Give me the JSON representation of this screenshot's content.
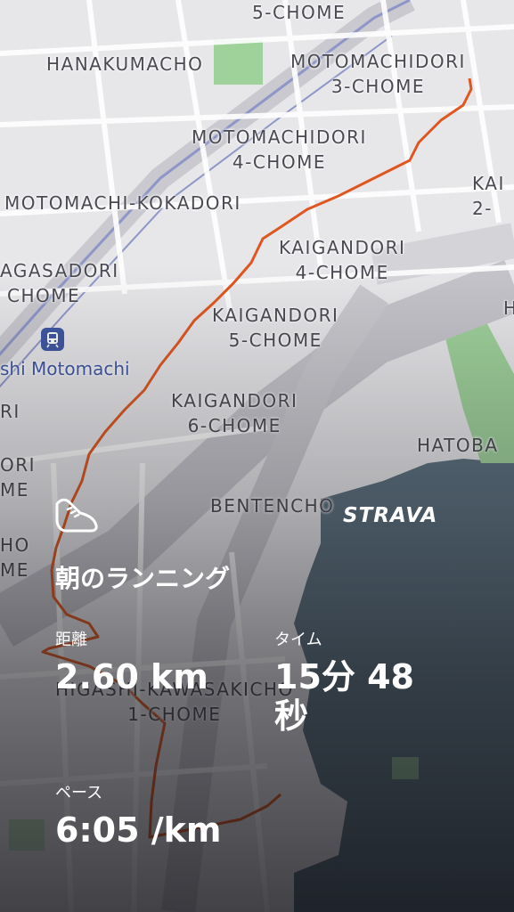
{
  "map": {
    "labels": {
      "chome5_top": "5-CHOME",
      "hanakumacho": "HANAKUMACHO",
      "motomachidori3_a": "MOTOMACHIDORI",
      "motomachidori3_b": "3-CHOME",
      "motomachidori4_a": "MOTOMACHIDORI",
      "motomachidori4_b": "4-CHOME",
      "kokadori": "MOTOMACHI-KOKADORI",
      "kaigandori4_a": "KAIGANDORI",
      "kaigandori4_b": "4-CHOME",
      "nagasadori_a": "AGASADORI",
      "nagasadori_b": "CHOME",
      "kaigandori5_a": "KAIGANDORI",
      "kaigandori5_b": "5-CHOME",
      "kaigandori6_a": "KAIGANDORI",
      "kaigandori6_b": "6-CHOME",
      "bentencho": "BENTENCHO",
      "hatoba": "HATOBA",
      "kai_right_a": "KAI",
      "kai_right_b": "2-",
      "h_right": "H",
      "left_ri1": "RI",
      "left_ori": "ORI",
      "left_me": "ME",
      "left_ho": "HO",
      "left_me2": "ME",
      "kawasaki_a": "HIGASHI-KAWASAKICHO",
      "kawasaki_b": "1-CHOME"
    },
    "station_name": "shi Motomachi",
    "route_color": "#e0561f"
  },
  "brand": "STRAVA",
  "activity": {
    "icon": "running-shoe-icon",
    "title": "朝のランニング",
    "distance_label": "距離",
    "distance_value": "2.60 km",
    "time_label": "タイム",
    "time_value": "15分 48 秒",
    "pace_label": "ペース",
    "pace_value": "6:05 /km"
  }
}
